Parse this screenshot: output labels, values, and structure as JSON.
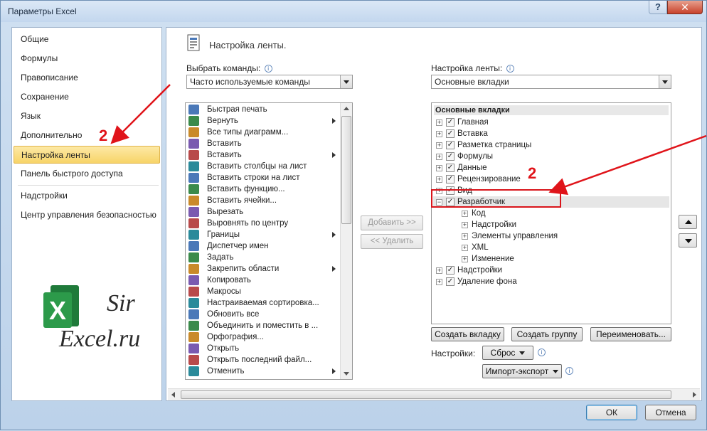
{
  "window": {
    "title": "Параметры Excel",
    "help": "?",
    "close": "✕"
  },
  "nav": {
    "items": [
      {
        "label": "Общие"
      },
      {
        "label": "Формулы"
      },
      {
        "label": "Правописание"
      },
      {
        "label": "Сохранение"
      },
      {
        "label": "Язык"
      },
      {
        "label": "Дополнительно"
      },
      {
        "label": "Настройка ленты",
        "selected": true
      },
      {
        "label": "Панель быстрого доступа"
      },
      {
        "label": "Надстройки"
      },
      {
        "label": "Центр управления безопасностью"
      }
    ],
    "watermark_text": "Sir Excel.ru"
  },
  "main": {
    "heading": "Настройка ленты.",
    "choose_label": "Выбрать команды:",
    "choose_value": "Часто используемые команды",
    "ribbon_label": "Настройка ленты:",
    "ribbon_value": "Основные вкладки",
    "commands": [
      {
        "label": "Быстрая печать",
        "icon": "print-icon"
      },
      {
        "label": "Вернуть",
        "icon": "redo-icon",
        "submenu": true
      },
      {
        "label": "Все типы диаграмм...",
        "icon": "chart-icon"
      },
      {
        "label": "Вставить",
        "icon": "paste-icon"
      },
      {
        "label": "Вставить",
        "icon": "paste-icon",
        "submenu": true
      },
      {
        "label": "Вставить столбцы на лист",
        "icon": "insert-columns-icon"
      },
      {
        "label": "Вставить строки на лист",
        "icon": "insert-rows-icon"
      },
      {
        "label": "Вставить функцию...",
        "icon": "function-icon"
      },
      {
        "label": "Вставить ячейки...",
        "icon": "insert-cells-icon"
      },
      {
        "label": "Вырезать",
        "icon": "cut-icon"
      },
      {
        "label": "Выровнять по центру",
        "icon": "align-center-icon"
      },
      {
        "label": "Границы",
        "icon": "borders-icon",
        "submenu": true
      },
      {
        "label": "Диспетчер имен",
        "icon": "name-manager-icon"
      },
      {
        "label": "Задать",
        "icon": "set-icon"
      },
      {
        "label": "Закрепить области",
        "icon": "freeze-panes-icon",
        "submenu": true
      },
      {
        "label": "Копировать",
        "icon": "copy-icon"
      },
      {
        "label": "Макросы",
        "icon": "macros-icon"
      },
      {
        "label": "Настраиваемая сортировка...",
        "icon": "sort-icon"
      },
      {
        "label": "Обновить все",
        "icon": "refresh-icon"
      },
      {
        "label": "Объединить и поместить в ...",
        "icon": "merge-icon"
      },
      {
        "label": "Орфография...",
        "icon": "spelling-icon"
      },
      {
        "label": "Открыть",
        "icon": "open-icon"
      },
      {
        "label": "Открыть последний файл...",
        "icon": "open-recent-icon"
      },
      {
        "label": "Отменить",
        "icon": "undo-icon",
        "submenu": true
      }
    ],
    "add_button": "Добавить >>",
    "remove_button": "<< Удалить",
    "tree_header": "Основные вкладки",
    "tree": [
      {
        "label": "Главная",
        "expander": "+",
        "checked": true,
        "level": 0
      },
      {
        "label": "Вставка",
        "expander": "+",
        "checked": true,
        "level": 0
      },
      {
        "label": "Разметка страницы",
        "expander": "+",
        "checked": true,
        "level": 0
      },
      {
        "label": "Формулы",
        "expander": "+",
        "checked": true,
        "level": 0
      },
      {
        "label": "Данные",
        "expander": "+",
        "checked": true,
        "level": 0
      },
      {
        "label": "Рецензирование",
        "expander": "+",
        "checked": true,
        "level": 0
      },
      {
        "label": "Вид",
        "expander": "+",
        "checked": true,
        "level": 0
      },
      {
        "label": "Разработчик",
        "expander": "−",
        "checked": true,
        "level": 0,
        "selected": true
      },
      {
        "label": "Код",
        "expander": "+",
        "level": 1
      },
      {
        "label": "Надстройки",
        "expander": "+",
        "level": 1
      },
      {
        "label": "Элементы управления",
        "expander": "+",
        "level": 1
      },
      {
        "label": "XML",
        "expander": "+",
        "level": 1
      },
      {
        "label": "Изменение",
        "expander": "+",
        "level": 1
      },
      {
        "label": "Надстройки",
        "expander": "+",
        "checked": true,
        "level": 0
      },
      {
        "label": "Удаление фона",
        "expander": "+",
        "checked": true,
        "level": 0
      }
    ],
    "create_tab": "Создать вкладку",
    "create_group": "Создать группу",
    "rename": "Переименовать...",
    "settings_label": "Настройки:",
    "reset": "Сброс",
    "import_export": "Импорт-экспорт"
  },
  "footer": {
    "ok": "ОК",
    "cancel": "Отмена"
  },
  "annotations": [
    {
      "number": "2"
    },
    {
      "number": "2"
    }
  ],
  "colors": {
    "annotation": "#e0141a",
    "selected_nav": "#f7d468"
  }
}
